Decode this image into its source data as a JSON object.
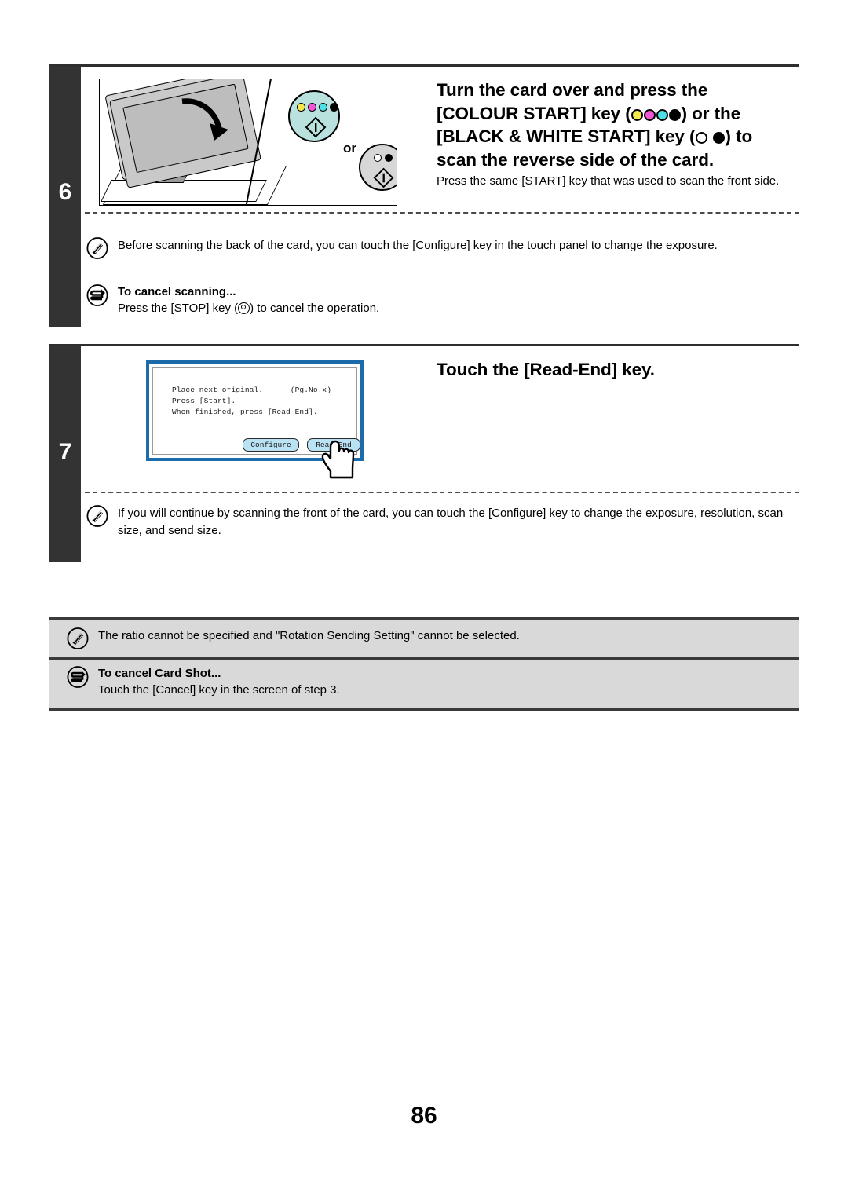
{
  "page": {
    "number": "86"
  },
  "steps": [
    {
      "number": "6",
      "heading_lines": [
        "Turn the card over and press the",
        "[COLOUR START] key (",
        ") or the",
        "[BLACK & WHITE START] key (",
        ") to",
        "scan the reverse side of the card."
      ],
      "heading_plain": "Turn the card over and press the [COLOUR START] key ( ) or the [BLACK & WHITE START] key ( ) to scan the reverse side of the card.",
      "subtext": "Press the same [START] key that was used to scan the front side.",
      "illustration": {
        "or_label": "or",
        "colour_key_name": "colour-start-key",
        "bw_key_name": "black-white-start-key",
        "colour_key_fill": "#b9e2de",
        "bw_key_fill": "#d7d7d7",
        "cmyk_dots": [
          "#f5e84a",
          "#f255d6",
          "#4ee0e8",
          "#000000"
        ]
      },
      "notes": [
        {
          "icon": "pencil-note-icon",
          "title": "",
          "text": "Before scanning the back of the card, you can touch the [Configure] key in the touch panel to change the exposure."
        },
        {
          "icon": "cancel-arrow-icon",
          "title": "To cancel scanning...",
          "text_before": "Press the [STOP] key (",
          "text_after": ") to cancel the operation."
        }
      ]
    },
    {
      "number": "7",
      "heading_plain": "Touch the [Read-End] key.",
      "panel": {
        "lines": [
          "Place next original.      (Pg.No.x)",
          "Press [Start].",
          "When finished, press [Read-End]."
        ],
        "buttons": [
          {
            "label": "Configure",
            "name": "configure-button"
          },
          {
            "label": "Read-End",
            "name": "read-end-button"
          }
        ],
        "border_color": "#1d6bab",
        "button_fill": "#b9e2f3"
      },
      "notes": [
        {
          "icon": "pencil-note-icon",
          "title": "",
          "text": "If you will continue by scanning the front of the card, you can touch the [Configure] key to change the exposure, resolution, scan size, and send size."
        }
      ]
    }
  ],
  "footer_notes": [
    {
      "icon": "pencil-note-icon",
      "title": "",
      "text": "The ratio cannot be specified and \"Rotation Sending Setting\" cannot be selected."
    },
    {
      "icon": "cancel-arrow-icon",
      "title": "To cancel Card Shot...",
      "text": "Touch the [Cancel] key in the screen of step 3."
    }
  ]
}
